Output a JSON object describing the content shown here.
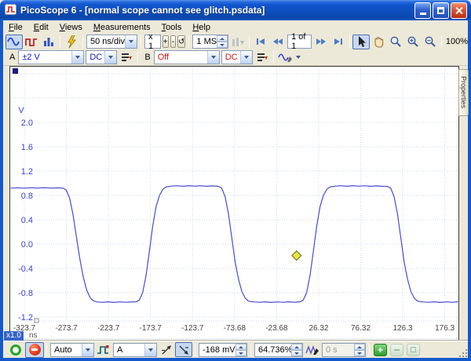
{
  "window": {
    "title": "PicoScope 6 - [normal scope cannot see glitch.psdata]"
  },
  "menu": {
    "items": [
      "File",
      "Edit",
      "Views",
      "Measurements",
      "Tools",
      "Help"
    ]
  },
  "toolbar": {
    "timebase": "50 ns/div",
    "zoom_x": "x 1",
    "zoom_in": "+",
    "zoom_out": "-",
    "zoom_reset": "↺",
    "samples": "1 MS",
    "page": "1 of 1",
    "zoom_percent": "100%"
  },
  "channels": {
    "a": {
      "label": "A",
      "range": "±2 V",
      "coupling": "DC"
    },
    "b": {
      "label": "B",
      "range": "Off",
      "coupling": "DC"
    }
  },
  "graph": {
    "v_unit": "V",
    "t_unit": "ns",
    "zoom_badge": "x1.0",
    "properties_tab": "Properties"
  },
  "status": {
    "trigger_mode": "Auto",
    "source": "A",
    "level": "-168 mV",
    "pretrigger": "64.736%",
    "delay": "0 s",
    "add": "+"
  },
  "colors": {
    "accent": "#316ac5",
    "titlebar": "#0d4fc0",
    "trace": "#4a4ad0",
    "grid": "#c9d9ea",
    "channel_a_text": "#1616c8",
    "channel_b_text": "#d01414",
    "trigger_marker": "#e8e44c"
  },
  "icons": {
    "app-icon": "red-scope-trace",
    "scope-view-icon": "blue-sine-wave",
    "persistence-view-icon": "red-square-wave",
    "spectrum-view-icon": "blue-bar-chart",
    "connect-device-icon": "yellow-lightning",
    "buffer-overview-icon": "gray-bars-arrow",
    "selection-tool-icon": "black-pointer-arrow",
    "hand-tool-icon": "hand",
    "zoom-tool-icons": "magnifier, magnifier-plus, magnifier-minus",
    "go-icon": "green-ring",
    "stop-icon": "red-circle-white-bar",
    "advanced-trigger-icon": "teal-square-wave-red-dot",
    "edge-icons": "rising-edge, falling-edge",
    "signal-generator-icon": "sine-with-pen"
  },
  "chart_data": {
    "type": "line",
    "title": "",
    "xlabel": "ns",
    "ylabel": "V",
    "xlim": [
      -339.6,
      191.6
    ],
    "ylim": [
      -1.265,
      2.916
    ],
    "grid": true,
    "x_ticks": [
      {
        "v": -323.7,
        "label": "-323.7"
      },
      {
        "v": -273.7,
        "label": "-273.7"
      },
      {
        "v": -223.7,
        "label": "-223.7"
      },
      {
        "v": -173.7,
        "label": "-173.7"
      },
      {
        "v": -123.7,
        "label": "-123.7"
      },
      {
        "v": -73.68,
        "label": "-73.68"
      },
      {
        "v": -23.68,
        "label": "-23.68"
      },
      {
        "v": 26.32,
        "label": "26.32"
      },
      {
        "v": 76.32,
        "label": "76.32"
      },
      {
        "v": 126.3,
        "label": "126.3"
      },
      {
        "v": 176.3,
        "label": "176.3"
      }
    ],
    "grid_y": [
      2.8,
      2.4,
      2.0,
      1.6,
      1.2,
      0.8,
      0.4,
      0.0,
      -0.4,
      -0.8,
      -1.2
    ],
    "y_ticks": [
      {
        "v": 2.0,
        "label": "2.0"
      },
      {
        "v": 1.6,
        "label": "1.6"
      },
      {
        "v": 1.2,
        "label": "1.2"
      },
      {
        "v": 0.8,
        "label": "0.8"
      },
      {
        "v": 0.4,
        "label": "0.4"
      },
      {
        "v": 0.0,
        "label": "0.0"
      },
      {
        "v": -0.4,
        "label": "-0.4"
      },
      {
        "v": -0.8,
        "label": "-0.8"
      },
      {
        "v": -1.2,
        "label": "-1.2"
      }
    ],
    "trigger_marker": {
      "t": 0,
      "v": -0.19
    },
    "series": [
      {
        "name": "Channel A",
        "color": "#4a4ad0",
        "points": [
          [
            -339.6,
            0.92
          ],
          [
            -332,
            0.925
          ],
          [
            -324,
            0.918
          ],
          [
            -316,
            0.926
          ],
          [
            -308,
            0.92
          ],
          [
            -300,
            0.927
          ],
          [
            -292,
            0.92
          ],
          [
            -284,
            0.924
          ],
          [
            -278,
            0.92
          ],
          [
            -274,
            0.89
          ],
          [
            -270,
            0.76
          ],
          [
            -266,
            0.5
          ],
          [
            -262,
            0.14
          ],
          [
            -258,
            -0.22
          ],
          [
            -254,
            -0.52
          ],
          [
            -250,
            -0.74
          ],
          [
            -246,
            -0.87
          ],
          [
            -242,
            -0.93
          ],
          [
            -238,
            -0.952
          ],
          [
            -231,
            -0.958
          ],
          [
            -224,
            -0.95
          ],
          [
            -217,
            -0.96
          ],
          [
            -210,
            -0.952
          ],
          [
            -203,
            -0.958
          ],
          [
            -196,
            -0.95
          ],
          [
            -191,
            -0.952
          ],
          [
            -187,
            -0.92
          ],
          [
            -183,
            -0.8
          ],
          [
            -179,
            -0.52
          ],
          [
            -175,
            -0.12
          ],
          [
            -171,
            0.3
          ],
          [
            -167,
            0.62
          ],
          [
            -163,
            0.8
          ],
          [
            -159,
            0.9
          ],
          [
            -155,
            0.94
          ],
          [
            -149,
            0.952
          ],
          [
            -142,
            0.958
          ],
          [
            -135,
            0.95
          ],
          [
            -128,
            0.96
          ],
          [
            -121,
            0.952
          ],
          [
            -114,
            0.958
          ],
          [
            -107,
            0.95
          ],
          [
            -100,
            0.956
          ],
          [
            -93,
            0.95
          ],
          [
            -89,
            0.92
          ],
          [
            -85,
            0.78
          ],
          [
            -81,
            0.5
          ],
          [
            -77,
            0.1
          ],
          [
            -73,
            -0.3
          ],
          [
            -69,
            -0.58
          ],
          [
            -65,
            -0.78
          ],
          [
            -61,
            -0.89
          ],
          [
            -57,
            -0.94
          ],
          [
            -51,
            -0.952
          ],
          [
            -44,
            -0.958
          ],
          [
            -37,
            -0.95
          ],
          [
            -30,
            -0.96
          ],
          [
            -23,
            -0.952
          ],
          [
            -16,
            -0.958
          ],
          [
            -9,
            -0.95
          ],
          [
            -2,
            -0.956
          ],
          [
            4,
            -0.95
          ],
          [
            8,
            -0.92
          ],
          [
            12,
            -0.8
          ],
          [
            16,
            -0.52
          ],
          [
            20,
            -0.12
          ],
          [
            24,
            0.3
          ],
          [
            28,
            0.62
          ],
          [
            32,
            0.8
          ],
          [
            36,
            0.9
          ],
          [
            40,
            0.94
          ],
          [
            46,
            0.952
          ],
          [
            53,
            0.958
          ],
          [
            60,
            0.95
          ],
          [
            67,
            0.96
          ],
          [
            74,
            0.952
          ],
          [
            81,
            0.958
          ],
          [
            88,
            0.95
          ],
          [
            95,
            0.956
          ],
          [
            102,
            0.95
          ],
          [
            108,
            0.948
          ],
          [
            112,
            0.92
          ],
          [
            116,
            0.78
          ],
          [
            120,
            0.5
          ],
          [
            124,
            0.1
          ],
          [
            128,
            -0.3
          ],
          [
            132,
            -0.58
          ],
          [
            136,
            -0.78
          ],
          [
            140,
            -0.89
          ],
          [
            144,
            -0.94
          ],
          [
            150,
            -0.952
          ],
          [
            157,
            -0.958
          ],
          [
            164,
            -0.95
          ],
          [
            171,
            -0.96
          ],
          [
            178,
            -0.952
          ],
          [
            185,
            -0.958
          ],
          [
            191.6,
            -0.95
          ]
        ]
      }
    ]
  }
}
